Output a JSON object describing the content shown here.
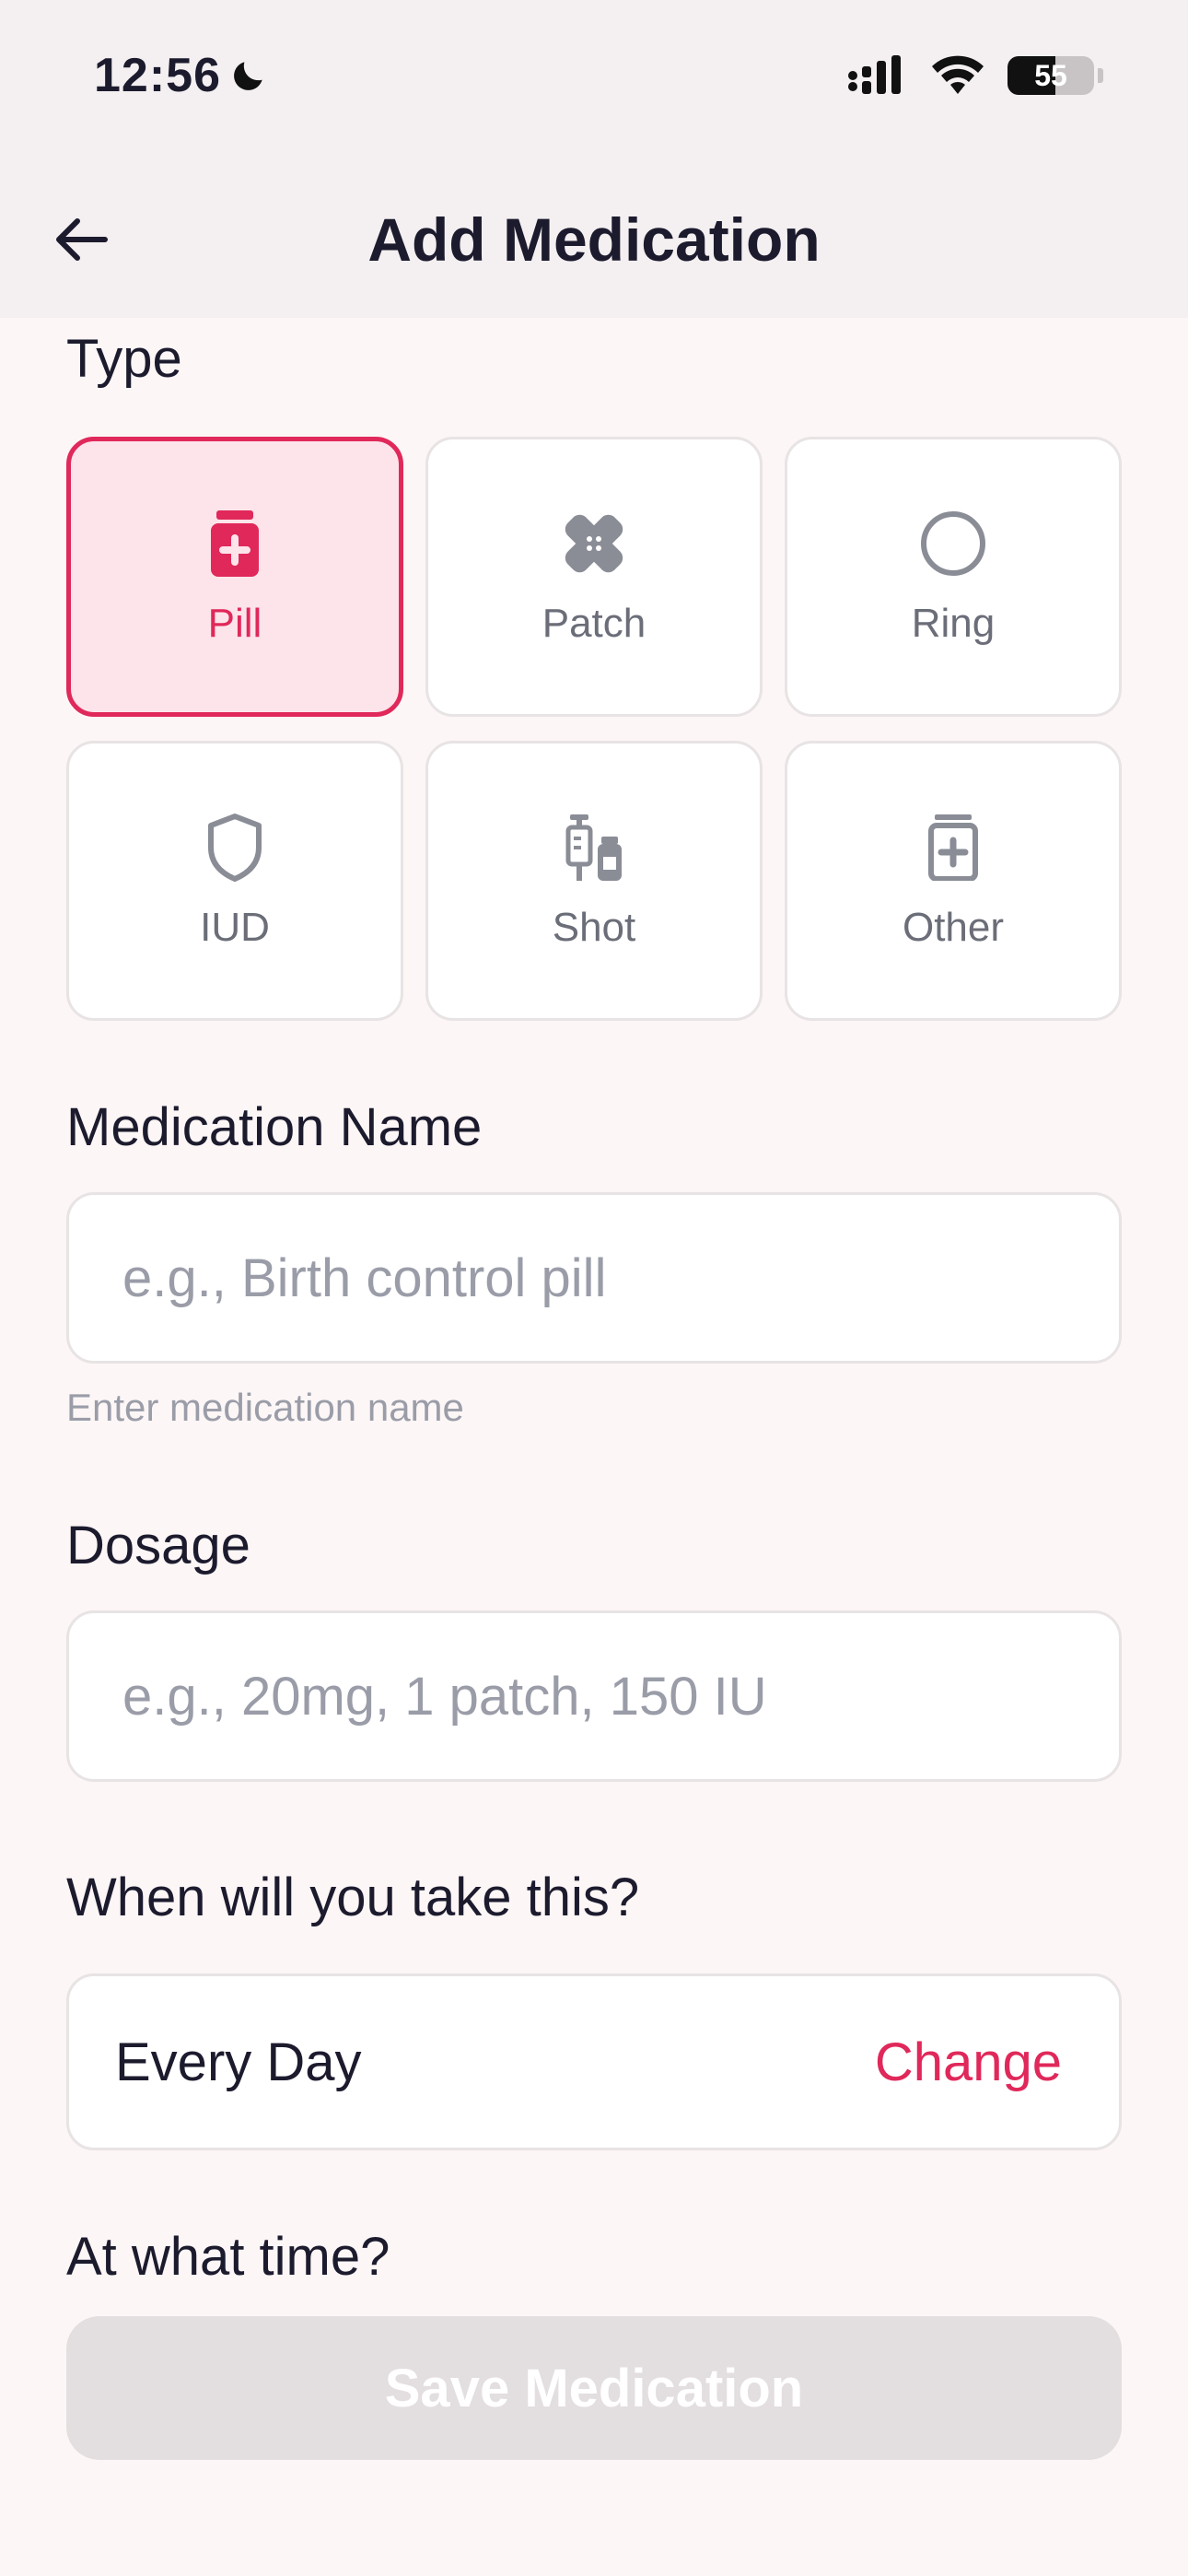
{
  "status_bar": {
    "time": "12:56",
    "battery_level": "55",
    "battery_fraction": 0.55
  },
  "header": {
    "title": "Add Medication"
  },
  "type_section": {
    "label": "Type",
    "options": [
      {
        "label": "Pill",
        "icon": "pill-bottle-icon",
        "selected": true
      },
      {
        "label": "Patch",
        "icon": "bandage-icon",
        "selected": false
      },
      {
        "label": "Ring",
        "icon": "ring-icon",
        "selected": false
      },
      {
        "label": "IUD",
        "icon": "shield-icon",
        "selected": false
      },
      {
        "label": "Shot",
        "icon": "syringe-vial-icon",
        "selected": false
      },
      {
        "label": "Other",
        "icon": "medicine-box-icon",
        "selected": false
      }
    ]
  },
  "medication_name": {
    "label": "Medication Name",
    "placeholder": "e.g., Birth control pill",
    "value": "",
    "helper": "Enter medication name"
  },
  "dosage": {
    "label": "Dosage",
    "placeholder": "e.g., 20mg, 1 patch, 150 IU",
    "value": ""
  },
  "schedule": {
    "label": "When will you take this?",
    "value": "Every Day",
    "change_label": "Change"
  },
  "time_section": {
    "label": "At what time?"
  },
  "save_button": {
    "label": "Save Medication",
    "enabled": false
  },
  "colors": {
    "accent": "#e0285a",
    "accent_bg": "#fde4ea",
    "icon_grey": "#8a8d96",
    "background": "#fdf6f6"
  }
}
